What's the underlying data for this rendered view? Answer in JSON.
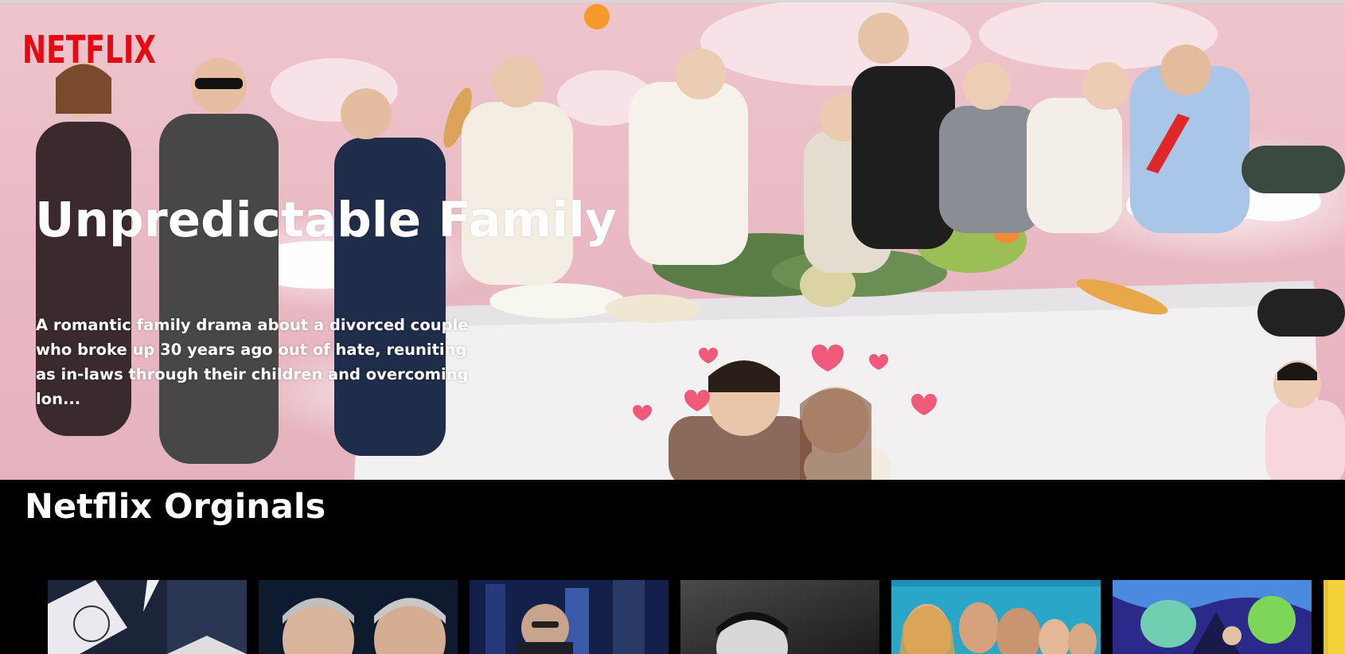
{
  "brand": {
    "name": "NETFLIX",
    "color": "#e50914"
  },
  "hero": {
    "title": "Unpredictable Family",
    "description": "A romantic family drama about a divorced couple who broke up 30 years ago out of hate, reuniting as in-laws through their children and overcoming lon..."
  },
  "rows": [
    {
      "title": "Netflix Orginals",
      "posters": [
        {
          "name": "poster-tonight-show"
        },
        {
          "name": "poster-talk-show-hosts"
        },
        {
          "name": "poster-late-show"
        },
        {
          "name": "poster-black-white-portrait"
        },
        {
          "name": "poster-cast-ensemble"
        },
        {
          "name": "poster-animated-heroes"
        },
        {
          "name": "poster-partial-yellow"
        }
      ]
    }
  ],
  "colors": {
    "background": "#000000",
    "banner_pink": "#eec5cd",
    "text": "#ffffff"
  }
}
